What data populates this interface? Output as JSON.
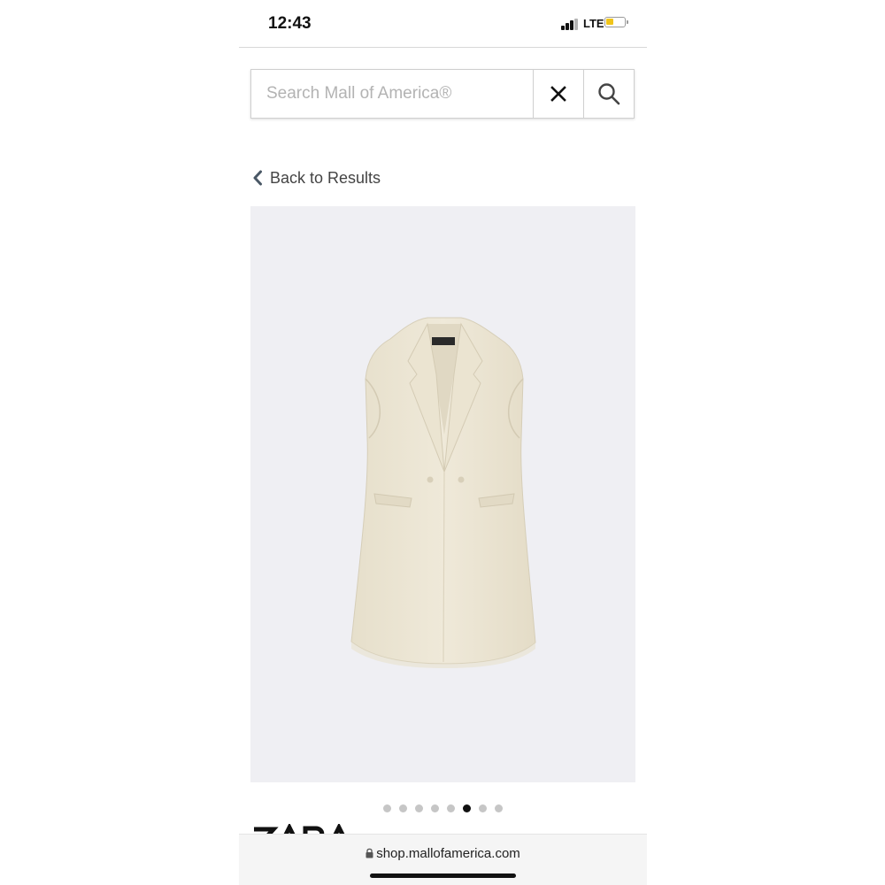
{
  "status_bar": {
    "time": "12:43",
    "network": "LTE",
    "battery_color": "#f0c419"
  },
  "search": {
    "placeholder": "Search Mall of America®",
    "value": "",
    "clear_icon": "close-icon",
    "search_icon": "search-icon"
  },
  "nav": {
    "back_label": "Back to Results",
    "back_icon": "chevron-left-icon"
  },
  "product": {
    "image_description_icon": "sleeveless-blazer-vest-image",
    "image_background": "#efeff3",
    "garment_color": "#ece5d3"
  },
  "carousel": {
    "total": 8,
    "active_index": 5
  },
  "brand": {
    "logo": "ZARA"
  },
  "browser": {
    "url": "shop.mallofamerica.com"
  }
}
